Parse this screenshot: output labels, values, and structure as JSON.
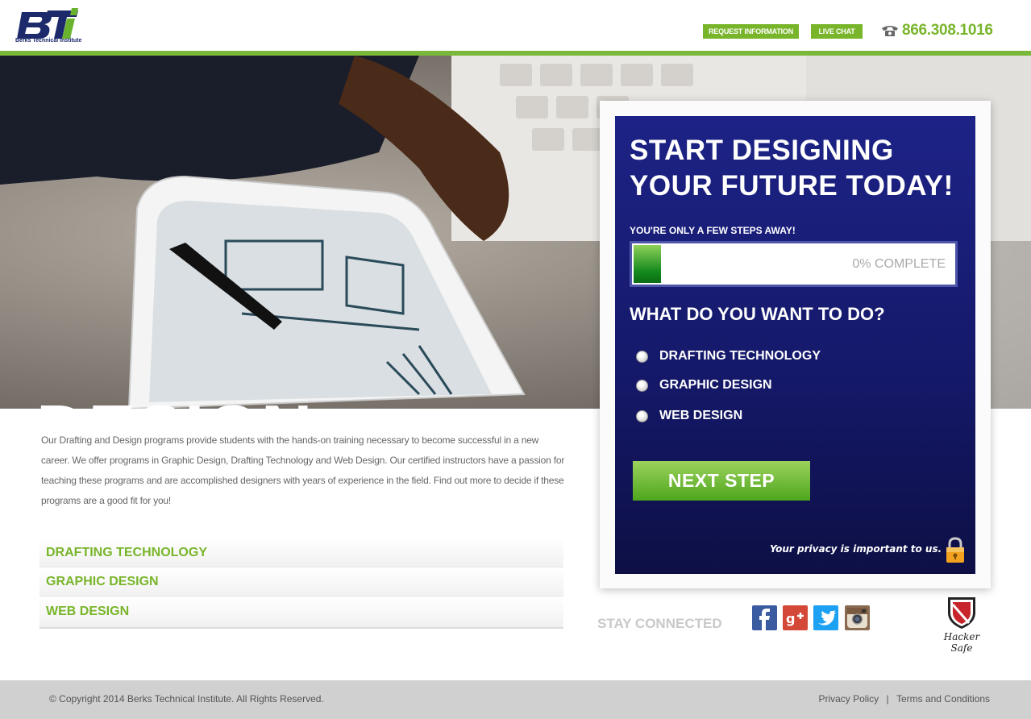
{
  "header": {
    "logo_text": "BTi",
    "logo_caption": "Berks Technical Institute",
    "request_info_label": "REQUEST INFORMATION",
    "live_chat_label": "LIVE CHAT",
    "phone_icon": "phone-icon",
    "phone_number": "866.308.1016"
  },
  "hero": {
    "title": "DESIGN"
  },
  "intro": {
    "text": "Our Drafting and Design programs provide students with the hands-on training necessary to become successful in a new career. We offer programs in Graphic Design, Drafting Technology and Web Design. Our certified instructors have a passion for teaching these programs and are accomplished designers with years of experience in the field. Find out more to decide if these programs are a good fit for you!"
  },
  "programs": [
    "DRAFTING TECHNOLOGY",
    "GRAPHIC DESIGN",
    "WEB DESIGN"
  ],
  "form": {
    "heading": "START DESIGNING YOUR FUTURE TODAY!",
    "steps_text": "YOU'RE ONLY A FEW STEPS AWAY!",
    "progress_text": "0% COMPLETE",
    "progress_value": 0,
    "question": "WHAT DO YOU WANT TO DO?",
    "options": [
      "DRAFTING TECHNOLOGY",
      "GRAPHIC DESIGN",
      "WEB DESIGN"
    ],
    "next_label": "NEXT STEP",
    "privacy_text": "Your privacy is important to us."
  },
  "social": {
    "stay_connected": "STAY CONNECTED",
    "icons": [
      "facebook-icon",
      "google-plus-icon",
      "twitter-icon",
      "instagram-icon"
    ]
  },
  "badge": {
    "hacker_safe_text": "Hacker Safe"
  },
  "footer": {
    "copyright": "© Copyright 2014  Berks Technical Institute. All Rights Reserved.",
    "privacy_policy": "Privacy Policy",
    "separator": "|",
    "terms": "Terms and Conditions"
  },
  "colors": {
    "brand_green": "#79b52b",
    "brand_navy": "#1d2386"
  }
}
